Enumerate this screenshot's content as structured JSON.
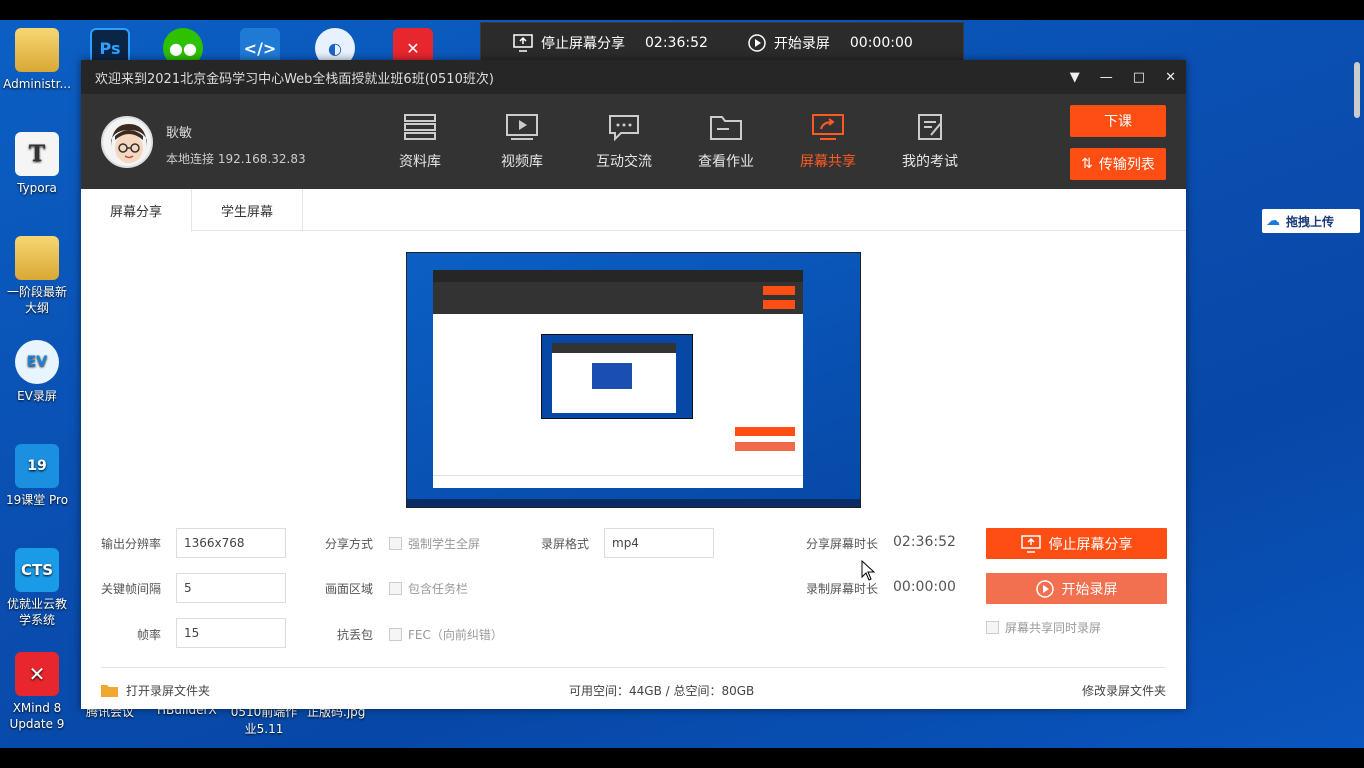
{
  "desktop": {
    "icons": [
      {
        "label": "Administr...",
        "name": "administrator-folder-icon"
      },
      {
        "label": "Typora",
        "name": "typora-icon"
      },
      {
        "label": "一阶段最新大纲",
        "name": "folder-doc-icon"
      },
      {
        "label": "EV录屏",
        "name": "ev-recorder-icon"
      },
      {
        "label": "19课堂 Pro",
        "name": "classroom-19-icon"
      },
      {
        "label": "优就业云教学系统",
        "name": "cts-icon"
      },
      {
        "label": "XMind 8 Update 9",
        "name": "xmind-icon"
      }
    ],
    "top_icons": [
      "Ps",
      "WeChat",
      "VS Code",
      "Browser",
      "XMind"
    ],
    "behind_labels": [
      "腾讯会议",
      "HBuilderX",
      "0510前端作业5.11",
      "正版码.jpg"
    ],
    "side_upload": "拖拽上传"
  },
  "share_bar": {
    "stop_label": "停止屏幕分享",
    "share_time": "02:36:52",
    "record_label": "开始录屏",
    "record_time": "00:00:00"
  },
  "window": {
    "title": "欢迎来到2021北京金码学习中心Web全栈面授就业班6班(0510班次)",
    "controls": [
      "▼",
      "—",
      "□",
      "✕"
    ]
  },
  "user": {
    "name": "耿敏",
    "connection": "本地连接 192.168.32.83"
  },
  "nav": [
    {
      "label": "资料库",
      "icon": "server-icon"
    },
    {
      "label": "视频库",
      "icon": "video-icon"
    },
    {
      "label": "互动交流",
      "icon": "chat-icon"
    },
    {
      "label": "查看作业",
      "icon": "folder-icon"
    },
    {
      "label": "屏幕共享",
      "icon": "screen-share-icon",
      "active": true
    },
    {
      "label": "我的考试",
      "icon": "exam-icon"
    }
  ],
  "header_buttons": {
    "end_class": "下课",
    "transfer_list": "传输列表"
  },
  "tabs": [
    "屏幕分享",
    "学生屏幕"
  ],
  "form": {
    "resolution_label": "输出分辨率",
    "resolution_value": "1366x768",
    "keyframe_label": "关键帧间隔",
    "keyframe_value": "5",
    "fps_label": "帧率",
    "fps_value": "15",
    "share_mode_label": "分享方式",
    "share_mode_option": "强制学生全屏",
    "area_label": "画面区域",
    "area_option": "包含任务栏",
    "fec_label": "抗丢包",
    "fec_option": "FEC（向前纠错）",
    "format_label": "录屏格式",
    "format_value": "mp4",
    "share_duration_label": "分享屏幕时长",
    "share_duration_value": "02:36:52",
    "record_duration_label": "录制屏幕时长",
    "record_duration_value": "00:00:00",
    "stop_share_button": "停止屏幕分享",
    "start_record_button": "开始录屏",
    "record_while_share": "屏幕共享同时录屏"
  },
  "footer": {
    "open_folder": "打开录屏文件夹",
    "space": "可用空间：44GB / 总空间：80GB",
    "change_folder": "修改录屏文件夹"
  },
  "colors": {
    "accent": "#ff4e13",
    "header_bg": "#333333",
    "titlebar_bg": "#262626",
    "desktop_bg": "#0a4eb0"
  }
}
